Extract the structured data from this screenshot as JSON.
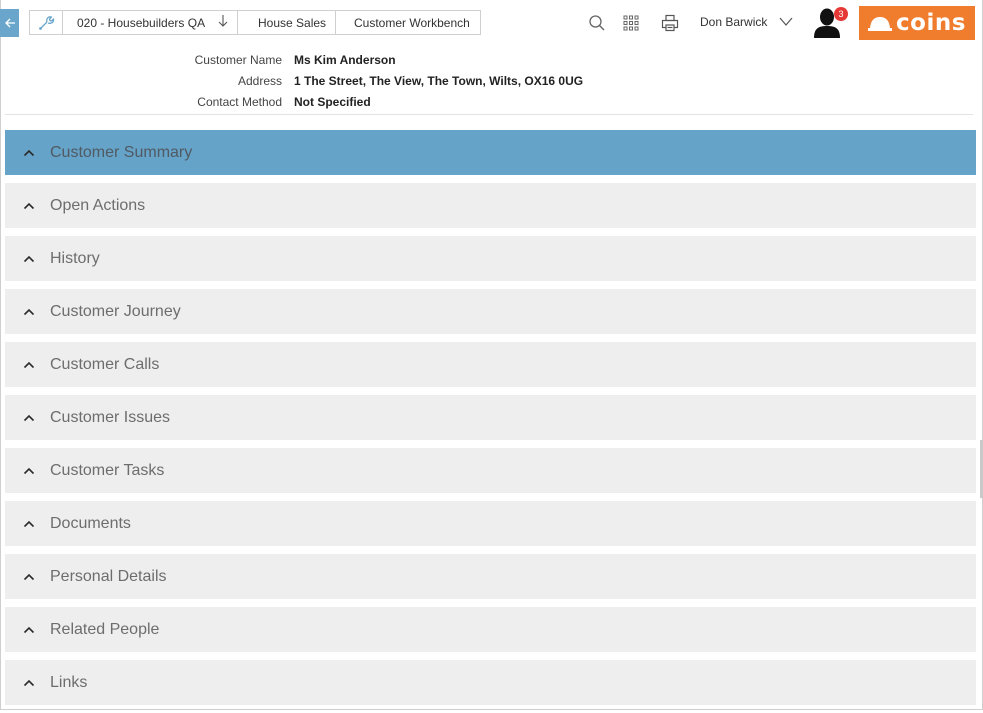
{
  "header": {
    "breadcrumb": [
      {
        "label": "020 - Housebuilders QA",
        "icon": "arrow-down-icon"
      },
      {
        "label": "House Sales"
      },
      {
        "label": "Customer Workbench"
      }
    ],
    "user_name": "Don Barwick",
    "notification_count": "3",
    "logo_text": "coins",
    "icons": [
      "back-arrow-icon",
      "wrench-icon",
      "search-icon",
      "apps-grid-icon",
      "print-icon",
      "chevron-down-icon",
      "user-icon"
    ]
  },
  "customer": {
    "fields": [
      {
        "label": "Customer Name",
        "value": "Ms Kim Anderson"
      },
      {
        "label": "Address",
        "value": "1 The Street, The View, The Town, Wilts, OX16 0UG"
      },
      {
        "label": "Contact Method",
        "value": "Not Specified"
      }
    ]
  },
  "sections": [
    {
      "label": "Customer Summary",
      "active": true
    },
    {
      "label": "Open Actions"
    },
    {
      "label": "History"
    },
    {
      "label": "Customer Journey"
    },
    {
      "label": "Customer Calls"
    },
    {
      "label": "Customer Issues"
    },
    {
      "label": "Customer Tasks"
    },
    {
      "label": "Documents"
    },
    {
      "label": "Personal Details"
    },
    {
      "label": "Related People"
    },
    {
      "label": "Links"
    }
  ],
  "colors": {
    "accent": "#66a3c8",
    "brand": "#f07d2e",
    "section_bg": "#eeeeee",
    "badge": "#e53935"
  }
}
